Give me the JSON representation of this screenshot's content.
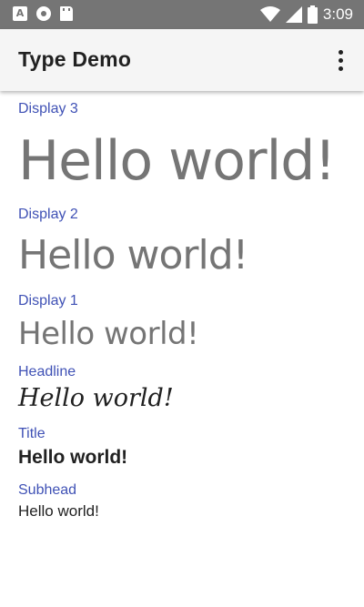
{
  "status_bar": {
    "time": "3:09",
    "left_icons": [
      "app-a-icon",
      "record-icon",
      "sd-card-icon"
    ],
    "right_icons": [
      "wifi-icon",
      "signal-icon",
      "battery-icon"
    ],
    "a_glyph": "A"
  },
  "app_bar": {
    "title": "Type Demo",
    "overflow_icon": "more-vert-icon"
  },
  "sections": [
    {
      "label": "Display 3",
      "sample": "Hello world!"
    },
    {
      "label": "Display 2",
      "sample": "Hello world!"
    },
    {
      "label": "Display 1",
      "sample": "Hello world!"
    },
    {
      "label": "Headline",
      "sample": "Hello world!"
    },
    {
      "label": "Title",
      "sample": "Hello world!"
    },
    {
      "label": "Subhead",
      "sample": "Hello world!"
    }
  ],
  "colors": {
    "status_bar": "#757575",
    "app_bar": "#f5f5f5",
    "label_accent": "#3f51b5",
    "display_text": "#757575",
    "body_text": "#212121"
  }
}
